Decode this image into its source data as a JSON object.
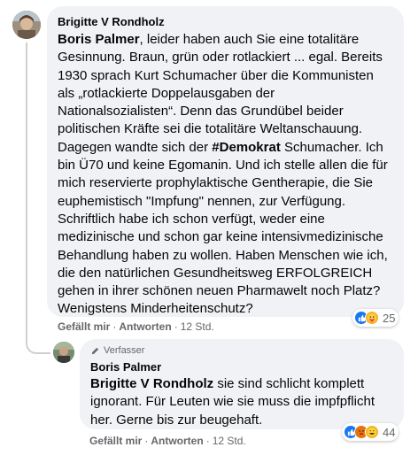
{
  "comment": {
    "author": "Brigitte V Rondholz",
    "mention": "Boris Palmer",
    "text_before_hashtag": ", leider haben auch Sie eine totalitäre Gesinnung. Braun, grün oder rotlackiert ... egal. Bereits 1930 sprach Kurt Schumacher über die Kommunisten als „rotlackierte Doppelausgaben der Nationalsozialisten“. Denn das Grundübel beider politischen Kräfte sei die totalitäre Weltanschauung. Dagegen wandte sich der ",
    "hashtag": "#Demokrat",
    "text_after_hashtag": " Schumacher. Ich bin Ü70 und keine Egomanin. Und ich stelle allen die für mich reservierte prophylaktische Gentherapie, die Sie euphemistisch \"Impfung\" nennen, zur Verfügung. Schriftlich habe ich schon verfügt, weder eine medizinische und schon gar keine intensivmedizinische Behandlung haben zu wollen. Haben Menschen wie ich, die den natürlichen Gesundheitsweg ERFOLGREICH gehen in ihrer schönen neuen Pharmawelt noch Platz? Wenigstens Minderheitenschutz?",
    "like_label": "Gefällt mir",
    "reply_label": "Antworten",
    "time": "12 Std.",
    "reaction_count": "25",
    "reaction_icons": [
      "like-icon",
      "care-icon"
    ]
  },
  "reply": {
    "badge": "Verfasser",
    "author": "Boris Palmer",
    "mention": "Brigitte V Rondholz",
    "text": " sie sind schlicht komplett ignorant. Für Leuten wie sie muss die impfpflicht her. Gerne bis zur beugehaft.",
    "like_label": "Gefällt mir",
    "reply_label": "Antworten",
    "time": "12 Std.",
    "reaction_count": "44",
    "reaction_icons": [
      "like-icon",
      "angry-icon",
      "haha-icon"
    ]
  },
  "separator": "·",
  "colors": {
    "bubble": "#f0f2f5",
    "like_blue": "#1877f2",
    "muted": "#65676b"
  }
}
